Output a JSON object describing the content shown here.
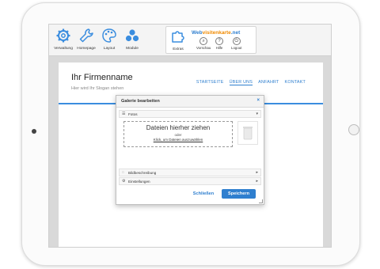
{
  "toolbar": {
    "tools": [
      {
        "label": "Verwaltung",
        "icon": "gear-icon"
      },
      {
        "label": "Homepage",
        "icon": "wrench-icon"
      },
      {
        "label": "Layout",
        "icon": "palette-icon"
      },
      {
        "label": "Module",
        "icon": "modules-icon"
      },
      {
        "label": "Extras",
        "icon": "puzzle-icon"
      }
    ],
    "brand": {
      "part1": "Web",
      "part2": "visitenkarte",
      "part3": ".net"
    },
    "mini_tools": [
      {
        "label": "Vorschau",
        "icon": "preview-icon"
      },
      {
        "label": "Hilfe",
        "icon": "help-icon"
      },
      {
        "label": "Logout",
        "icon": "power-icon"
      }
    ]
  },
  "site": {
    "title": "Ihr Firmenname",
    "slogan": "Hier wird Ihr Slogan stehen",
    "nav": [
      "STARTSEITE",
      "ÜBER UNS",
      "ANFAHRT",
      "KONTAKT"
    ]
  },
  "dialog": {
    "title": "Galerie bearbeiten",
    "close": "×",
    "photos_label": "Fotos",
    "drop_title": "Dateien hierher ziehen",
    "drop_or": "oder",
    "drop_link": "Klick, um Dateien auszuwählen",
    "sections": [
      "Bildbeschreibung",
      "Einstellungen"
    ],
    "close_button": "Schließen",
    "save_button": "Speichern"
  },
  "colors": {
    "accent": "#2f7fcf",
    "brand_orange": "#f08a00"
  }
}
